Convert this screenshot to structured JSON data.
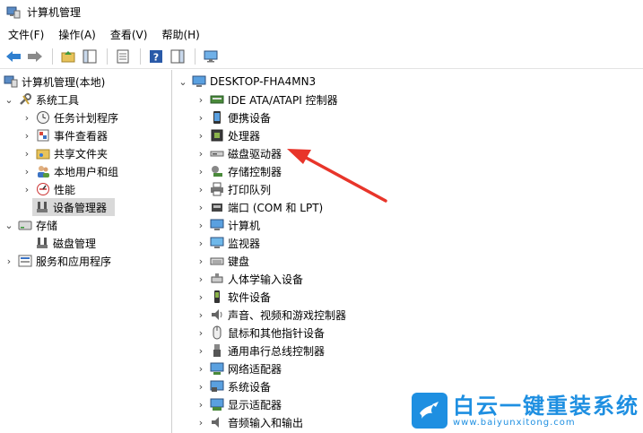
{
  "window": {
    "title": "计算机管理",
    "icon": "computer-management-icon"
  },
  "menubar": {
    "items": [
      "文件(F)",
      "操作(A)",
      "查看(V)",
      "帮助(H)"
    ]
  },
  "toolbar": {
    "buttons": [
      "back-arrow-icon",
      "forward-arrow-icon",
      "folder-up-icon",
      "show-hide-tree-icon",
      "properties-icon",
      "help-icon",
      "action-pane-icon",
      "monitor-icon"
    ]
  },
  "left_tree": {
    "root": "计算机管理(本地)",
    "items": [
      {
        "label": "系统工具",
        "icon": "tools-icon"
      },
      {
        "label": "任务计划程序",
        "icon": "clock-icon"
      },
      {
        "label": "事件查看器",
        "icon": "event-viewer-icon"
      },
      {
        "label": "共享文件夹",
        "icon": "shared-folder-icon"
      },
      {
        "label": "本地用户和组",
        "icon": "users-icon"
      },
      {
        "label": "性能",
        "icon": "performance-icon"
      },
      {
        "label": "设备管理器",
        "icon": "device-manager-icon"
      },
      {
        "label": "存储",
        "icon": "storage-icon"
      },
      {
        "label": "磁盘管理",
        "icon": "disk-management-icon"
      },
      {
        "label": "服务和应用程序",
        "icon": "services-icon"
      }
    ]
  },
  "device_tree": {
    "root": "DESKTOP-FHA4MN3",
    "items": [
      {
        "label": "IDE ATA/ATAPI 控制器",
        "icon": "ide-controller-icon"
      },
      {
        "label": "便携设备",
        "icon": "portable-device-icon"
      },
      {
        "label": "处理器",
        "icon": "processor-icon"
      },
      {
        "label": "磁盘驱动器",
        "icon": "disk-drive-icon"
      },
      {
        "label": "存储控制器",
        "icon": "storage-controller-icon"
      },
      {
        "label": "打印队列",
        "icon": "printer-icon"
      },
      {
        "label": "端口 (COM 和 LPT)",
        "icon": "port-icon"
      },
      {
        "label": "计算机",
        "icon": "computer-icon"
      },
      {
        "label": "监视器",
        "icon": "monitor-icon"
      },
      {
        "label": "键盘",
        "icon": "keyboard-icon"
      },
      {
        "label": "人体学输入设备",
        "icon": "hid-icon"
      },
      {
        "label": "软件设备",
        "icon": "software-device-icon"
      },
      {
        "label": "声音、视频和游戏控制器",
        "icon": "speaker-icon"
      },
      {
        "label": "鼠标和其他指针设备",
        "icon": "mouse-icon"
      },
      {
        "label": "通用串行总线控制器",
        "icon": "usb-icon"
      },
      {
        "label": "网络适配器",
        "icon": "network-adapter-icon"
      },
      {
        "label": "系统设备",
        "icon": "system-device-icon"
      },
      {
        "label": "显示适配器",
        "icon": "display-adapter-icon"
      },
      {
        "label": "音频输入和输出",
        "icon": "audio-io-icon"
      }
    ]
  },
  "annotation": {
    "arrow_color": "#e8352a"
  },
  "watermark": {
    "title": "白云一键重装系统",
    "url": "www.baiyunxitong.com",
    "color": "#1e8fe1"
  }
}
